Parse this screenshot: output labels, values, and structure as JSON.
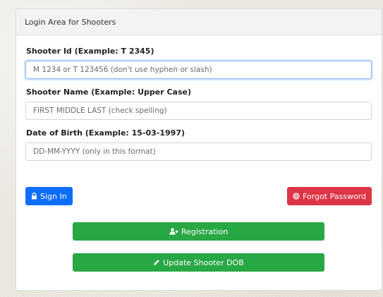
{
  "panel": {
    "title": "Login Area for Shooters"
  },
  "form": {
    "shooter_id": {
      "label": "Shooter Id (Example: T 2345)",
      "placeholder": "M 1234 or T 123456 (don't use hyphen or slash)"
    },
    "shooter_name": {
      "label": "Shooter Name (Example: Upper Case)",
      "placeholder": "FIRST MIDDLE LAST (check spelling)"
    },
    "dob": {
      "label": "Date of Birth (Example: 15-03-1997)",
      "placeholder": "DD-MM-YYYY (only in this format)"
    }
  },
  "buttons": {
    "sign_in": "Sign In",
    "forgot_password": "Forgot Password",
    "registration": "Registration",
    "update_dob": "Update Shooter DOB"
  },
  "icons": {
    "sign_in": "lock-icon",
    "forgot_password": "life-ring-icon",
    "registration": "user-plus-icon",
    "update_dob": "pencil-icon"
  },
  "colors": {
    "primary": "#0d6efd",
    "danger": "#dc3545",
    "success": "#28a745"
  }
}
